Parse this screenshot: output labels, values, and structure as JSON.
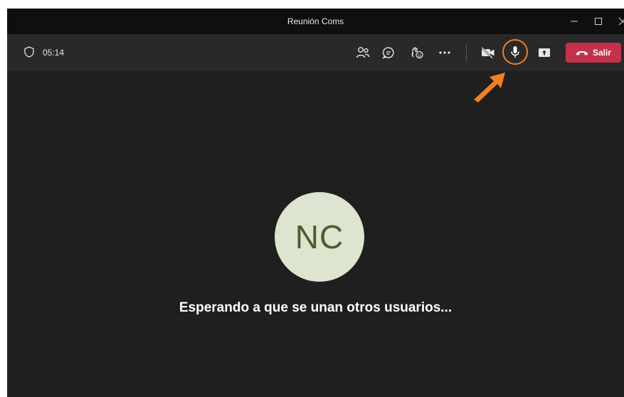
{
  "window": {
    "title": "Reunión Coms",
    "controls": [
      "minimize-icon",
      "maximize-icon",
      "close-icon"
    ]
  },
  "toolbar": {
    "security_icon": "shield-icon",
    "timer": "05:14",
    "buttons": [
      {
        "name": "participants",
        "icon": "people-icon"
      },
      {
        "name": "chat",
        "icon": "chat-icon"
      },
      {
        "name": "reactions",
        "icon": "raise-hand-icon"
      },
      {
        "name": "more",
        "icon": "more-icon"
      },
      {
        "name": "camera",
        "icon": "camera-off-icon"
      },
      {
        "name": "microphone",
        "icon": "microphone-icon"
      },
      {
        "name": "share",
        "icon": "share-screen-icon"
      }
    ],
    "leave_label": "Salir"
  },
  "highlight": {
    "color": "#f2801f",
    "target": "microphone"
  },
  "stage": {
    "avatar_initials": "NC",
    "status_text": "Esperando a que se unan otros usuarios..."
  },
  "colors": {
    "background": "#1f1f1f",
    "toolbar": "#292929",
    "leave_button": "#c4314b",
    "avatar_bg": "#dde4cf",
    "avatar_text": "#4a5e31"
  }
}
